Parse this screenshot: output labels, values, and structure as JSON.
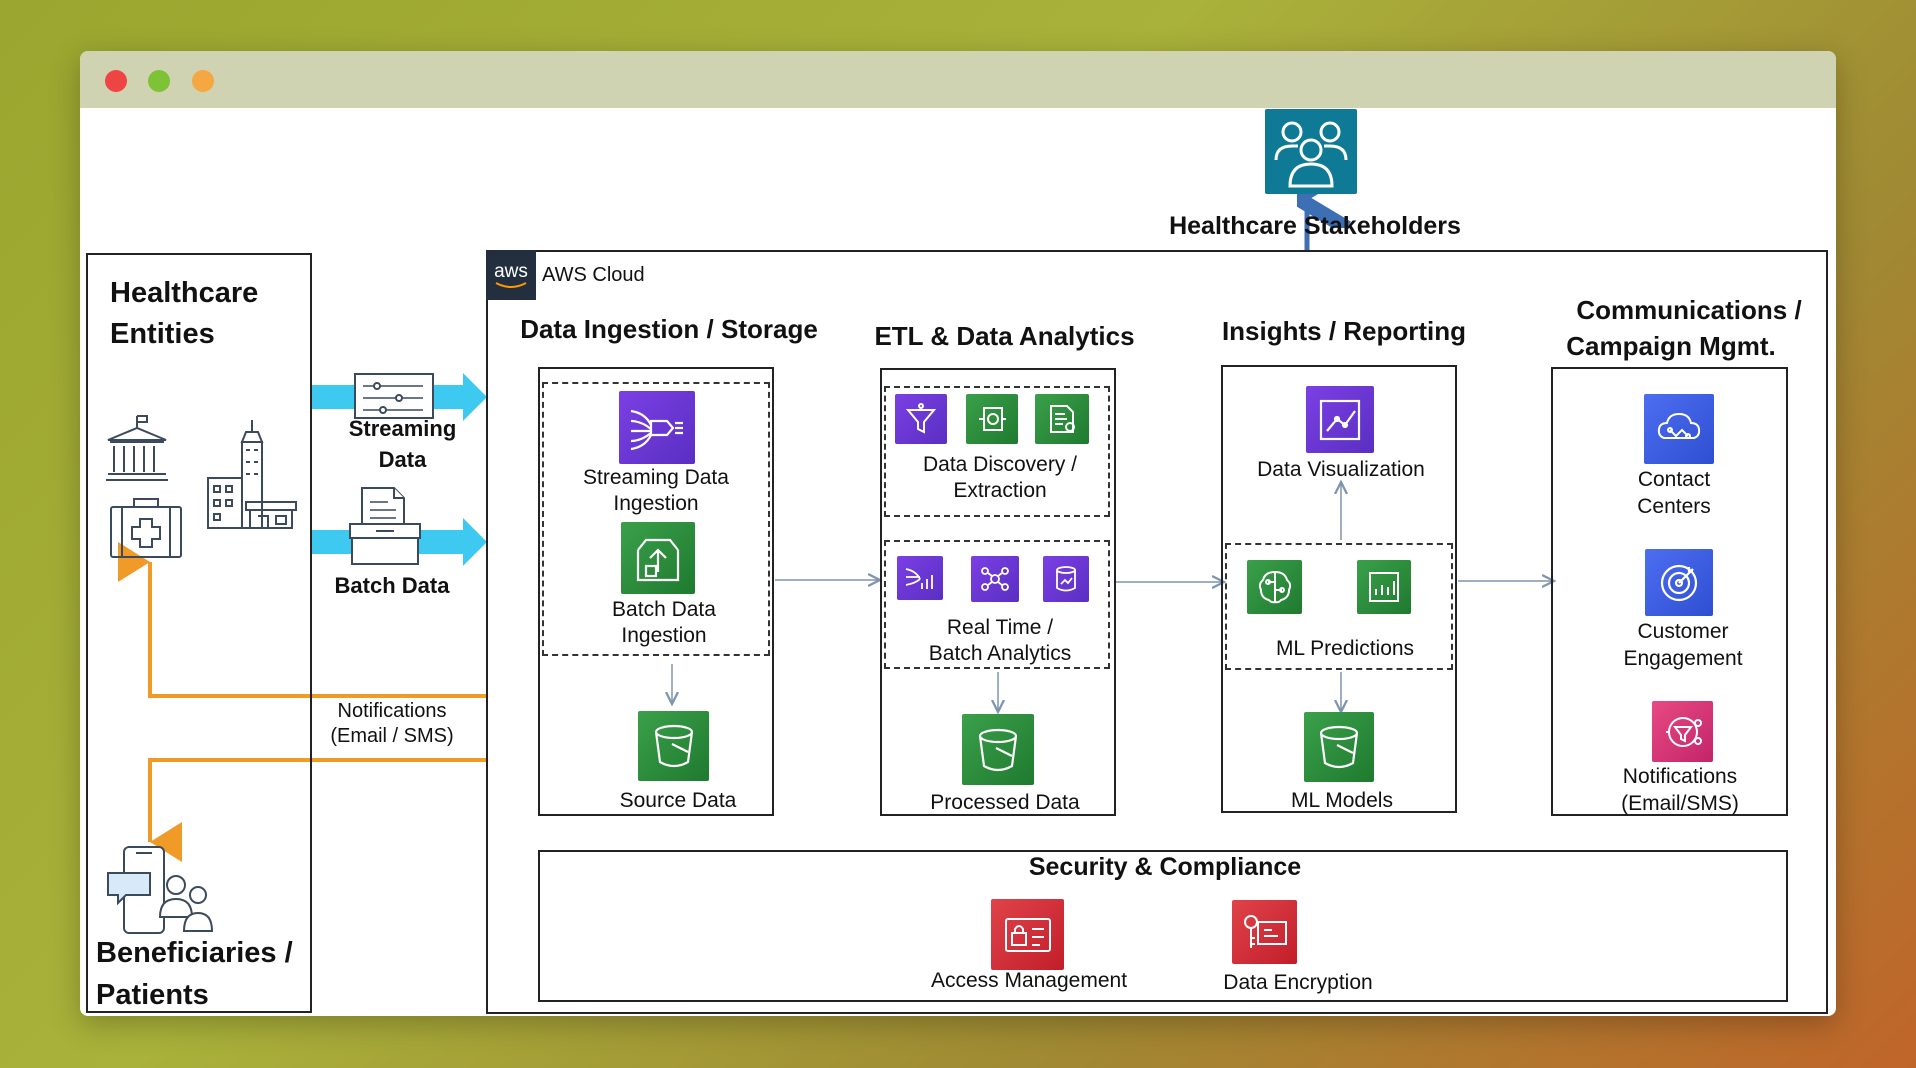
{
  "colors": {
    "accent_orange": "#f09a28",
    "accent_cyan": "#3ec9f0",
    "aws_dark": "#232f3e",
    "stakeholder_blue": "#3d6fb5"
  },
  "stakeholders": {
    "label": "Healthcare Stakeholders",
    "icon": "users-group-icon"
  },
  "healthcare_entities": {
    "title_line1": "Healthcare",
    "title_line2": "Entities"
  },
  "beneficiaries": {
    "title_line1": "Beneficiaries /",
    "title_line2": "Patients"
  },
  "inputs": {
    "streaming_line1": "Streaming",
    "streaming_line2": "Data",
    "batch": "Batch Data",
    "notifications_line1": "Notifications",
    "notifications_line2": "(Email / SMS)"
  },
  "aws": {
    "logo": "aws",
    "cloud_label": "AWS Cloud"
  },
  "sections": {
    "ingestion": {
      "title": "Data Ingestion / Storage",
      "streaming_line1": "Streaming Data",
      "streaming_line2": "Ingestion",
      "batch_line1": "Batch Data",
      "batch_line2": "Ingestion",
      "source": "Source Data"
    },
    "etl": {
      "title": "ETL & Data Analytics",
      "discovery_line1": "Data Discovery /",
      "discovery_line2": "Extraction",
      "analytics_line1": "Real Time /",
      "analytics_line2": "Batch Analytics",
      "processed": "Processed Data"
    },
    "insights": {
      "title": "Insights /  Reporting",
      "visualization": "Data Visualization",
      "ml_predictions": "ML  Predictions",
      "ml_models": "ML Models"
    },
    "comms": {
      "title_line1": "Communications /",
      "title_line2": "Campaign Mgmt.",
      "contact_line1": "Contact",
      "contact_line2": "Centers",
      "engagement_line1": "Customer",
      "engagement_line2": "Engagement",
      "notifications_line1": "Notifications",
      "notifications_line2": "(Email/SMS)"
    },
    "security": {
      "title": "Security & Compliance",
      "access": "Access Management",
      "encryption": "Data Encryption"
    }
  }
}
